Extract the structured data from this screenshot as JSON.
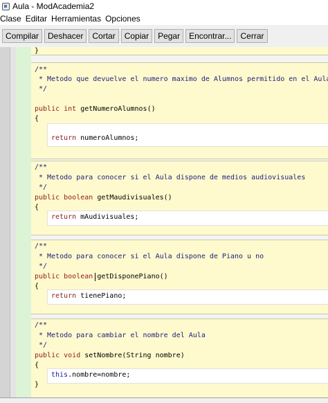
{
  "window": {
    "title": "Aula - ModAcademia2"
  },
  "menu": [
    "Clase",
    "Editar",
    "Herramientas",
    "Opciones"
  ],
  "toolbar": [
    "Compilar",
    "Deshacer",
    "Cortar",
    "Copiar",
    "Pegar",
    "Encontrar...",
    "Cerrar"
  ],
  "code": {
    "l0": "}",
    "b1_c1": "/**",
    "b1_c2": " * Metodo que devuelve el numero maximo de Alumnos permitido en el Aula",
    "b1_c3": " */",
    "b1_s1_kw": "public int ",
    "b1_s1_rest": "getNumeroAlumnos()",
    "b1_open": "{",
    "b1_ret_kw": "return ",
    "b1_ret_rest": "numeroAlumnos;",
    "b2_c1": "/**",
    "b2_c2": " * Metodo para conocer si el Aula dispone de medios audiovisuales",
    "b2_c3": " */",
    "b2_s1_kw": "public boolean ",
    "b2_s1_rest": "getMaudivisuales()",
    "b2_open": "{",
    "b2_ret_kw": "return ",
    "b2_ret_rest": "mAudivisuales;",
    "b3_c1": "/**",
    "b3_c2": " * Metodo para conocer si el Aula dispone de Piano u no",
    "b3_c3": " */",
    "b3_s1_kw": "public boolean ",
    "b3_s1_rest": "getDisponePiano()",
    "b3_open": "{",
    "b3_ret_kw": "return ",
    "b3_ret_rest": "tienePiano;",
    "b4_c1": "/**",
    "b4_c2": " * Metodo para cambiar el nombre del Aula",
    "b4_c3": " */",
    "b4_s1_kw": "public void ",
    "b4_s1_rest": "setNombre(String nombre)",
    "b4_open": "{",
    "b4_this_kw": "this",
    "b4_this_rest": ".nombre=nombre;",
    "b4_close": "}"
  },
  "colors": {
    "block_bg": "#fffacd",
    "gutter_green": "#dcf3d6",
    "keyword": "#8b1a1a",
    "comment": "#202080"
  }
}
